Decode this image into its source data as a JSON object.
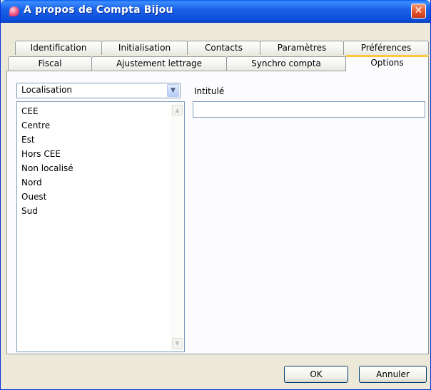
{
  "window": {
    "title": "A propos de Compta Bijou",
    "close_symbol": "✕",
    "icon": "app-icon"
  },
  "tabs_row1": [
    {
      "label": "Identification"
    },
    {
      "label": "Initialisation"
    },
    {
      "label": "Contacts"
    },
    {
      "label": "Paramètres"
    },
    {
      "label": "Préférences"
    }
  ],
  "tabs_row2": [
    {
      "label": "Fiscal"
    },
    {
      "label": "Ajustement lettrage"
    },
    {
      "label": "Synchro compta"
    },
    {
      "label": "Options",
      "active": true
    }
  ],
  "options": {
    "combo_value": "Localisation",
    "list_items": [
      "CEE",
      "Centre",
      "Est",
      "Hors CEE",
      "Non localisé",
      "Nord",
      "Ouest",
      "Sud"
    ],
    "intitule_label": "Intitulé",
    "intitule_value": ""
  },
  "buttons": {
    "ok": "OK",
    "cancel": "Annuler"
  },
  "colors": {
    "titlebar": "#0b4fdb",
    "active_tab_accent": "#ffc83c",
    "dialog_bg": "#ece9d8"
  }
}
